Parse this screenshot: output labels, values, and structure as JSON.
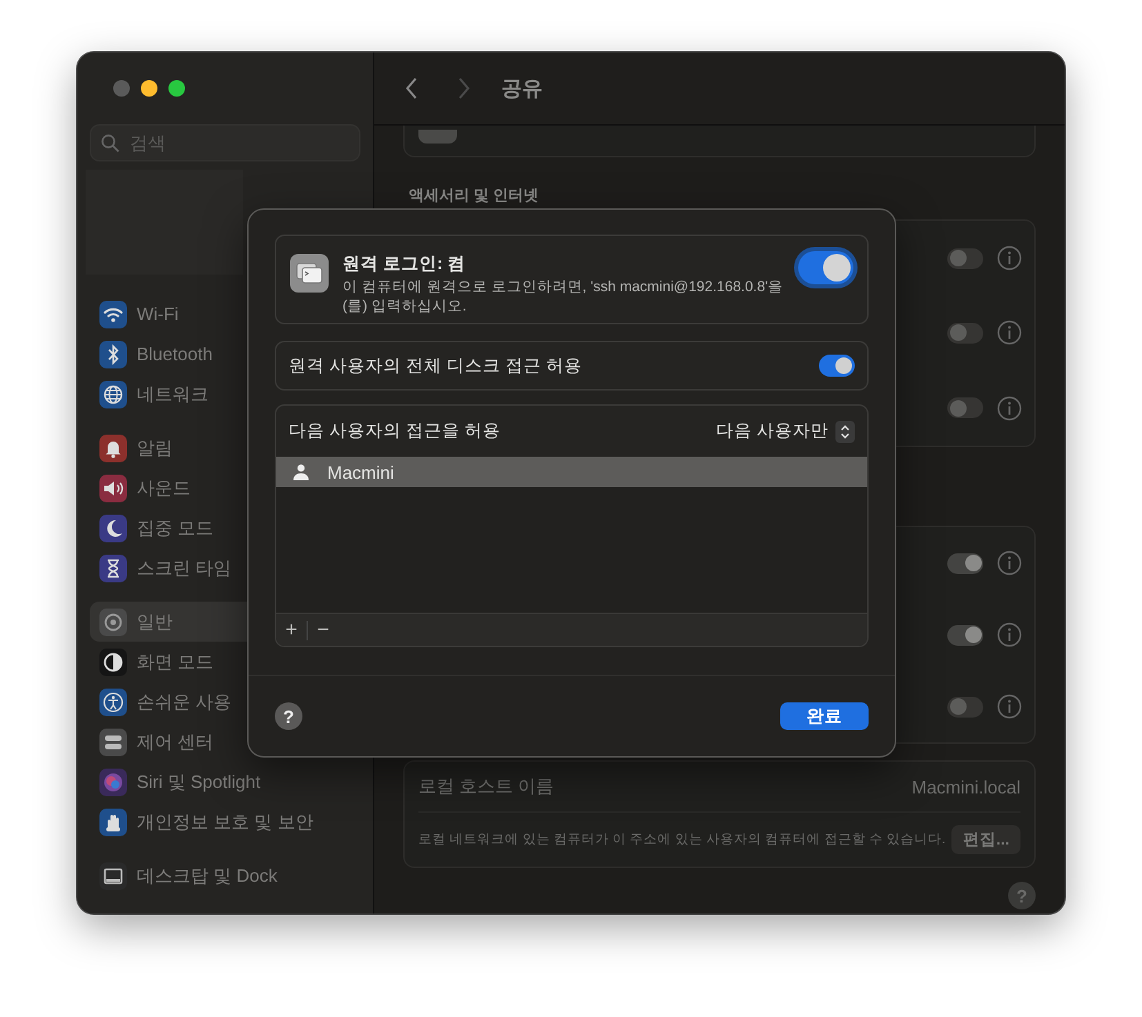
{
  "window": {
    "title": "공유"
  },
  "sidebar": {
    "search": {
      "placeholder": "검색"
    },
    "groups": [
      [
        {
          "label": "Wi-Fi",
          "color": "#1f4f8c",
          "selected": false
        },
        {
          "label": "Bluetooth",
          "color": "#1f4f8c",
          "selected": false
        },
        {
          "label": "네트워크",
          "color": "#1f4f8c",
          "selected": false
        }
      ],
      [
        {
          "label": "알림",
          "color": "#8c302c",
          "selected": false
        },
        {
          "label": "사운드",
          "color": "#8a2c40",
          "selected": false
        },
        {
          "label": "집중 모드",
          "color": "#3a3a85",
          "selected": false
        },
        {
          "label": "스크린 타임",
          "color": "#3a3a85",
          "selected": false
        }
      ],
      [
        {
          "label": "일반",
          "color": "#4a4a4a",
          "selected": true
        },
        {
          "label": "화면 모드",
          "color": "#151515",
          "selected": false
        },
        {
          "label": "손쉬운 사용",
          "color": "#1f4f8c",
          "selected": false
        },
        {
          "label": "제어 센터",
          "color": "#4a4a4a",
          "selected": false
        },
        {
          "label": "Siri 및 Spotlight",
          "color": "#3a2a5a",
          "selected": false
        },
        {
          "label": "개인정보 보호 및 보안",
          "color": "#1f4f8c",
          "selected": false
        }
      ],
      [
        {
          "label": "데스크탑 및 Dock",
          "color": "#2a2a2a",
          "selected": false
        }
      ]
    ]
  },
  "main": {
    "section_heading": "액세서리 및 인터넷",
    "toggle_cards": [
      [
        {
          "on": false
        },
        {
          "on": false
        },
        {
          "on": false
        }
      ],
      [
        {
          "on": true
        },
        {
          "on": true
        },
        {
          "on": false
        }
      ]
    ],
    "host_card": {
      "label": "로컬 호스트 이름",
      "value": "Macmini.local",
      "description": "로컬 네트워크에 있는 컴퓨터가 이 주소에 있는 사용자의 컴퓨터에 접근할 수 있습니다.",
      "button": "편집..."
    },
    "help": "?"
  },
  "sheet": {
    "remote_login": {
      "title": "원격 로그인: 켬",
      "description": "이 컴퓨터에 원격으로 로그인하려면, 'ssh macmini@192.168.0.8'을(를) 입력하십시오.",
      "on": true
    },
    "full_disk": {
      "label": "원격 사용자의 전체 디스크 접근 허용",
      "on": true
    },
    "access": {
      "label": "다음 사용자의 접근을 허용",
      "popup": "다음 사용자만",
      "users": [
        {
          "name": "Macmini",
          "selected": true
        }
      ],
      "add": "+",
      "remove": "−"
    },
    "help": "?",
    "done": "완료"
  }
}
